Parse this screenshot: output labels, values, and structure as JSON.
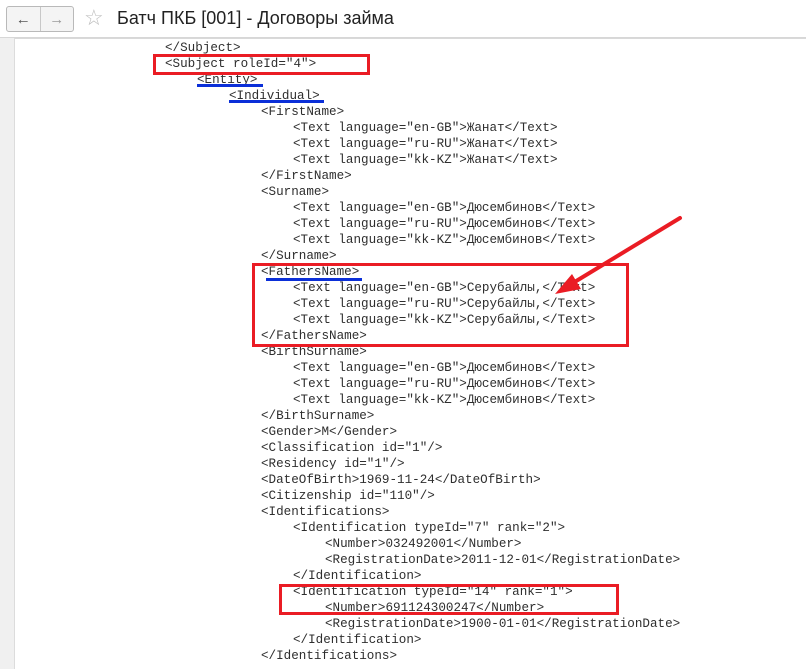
{
  "window": {
    "title": "Батч ПКБ [001] - Договоры займа",
    "back_glyph": "←",
    "forward_glyph": "→",
    "favorite_glyph": "☆"
  },
  "xml_lines": [
    "</Subject>",
    "<Subject roleId=\"4\">",
    "<Entity>",
    "<Individual>",
    "<FirstName>",
    "<Text language=\"en-GB\">Жанат</Text>",
    "<Text language=\"ru-RU\">Жанат</Text>",
    "<Text language=\"kk-KZ\">Жанат</Text>",
    "</FirstName>",
    "<Surname>",
    "<Text language=\"en-GB\">Дюсембинов</Text>",
    "<Text language=\"ru-RU\">Дюсембинов</Text>",
    "<Text language=\"kk-KZ\">Дюсембинов</Text>",
    "</Surname>",
    "<FathersName>",
    "<Text language=\"en-GB\">Серубайлы,</Text>",
    "<Text language=\"ru-RU\">Серубайлы,</Text>",
    "<Text language=\"kk-KZ\">Серубайлы,</Text>",
    "</FathersName>",
    "<BirthSurname>",
    "<Text language=\"en-GB\">Дюсембинов</Text>",
    "<Text language=\"ru-RU\">Дюсембинов</Text>",
    "<Text language=\"kk-KZ\">Дюсембинов</Text>",
    "</BirthSurname>",
    "<Gender>M</Gender>",
    "<Classification id=\"1\"/>",
    "<Residency id=\"1\"/>",
    "<DateOfBirth>1969-11-24</DateOfBirth>",
    "<Citizenship id=\"110\"/>",
    "<Identifications>",
    "<Identification typeId=\"7\" rank=\"2\">",
    "<Number>032492001</Number>",
    "<RegistrationDate>2011-12-01</RegistrationDate>",
    "</Identification>",
    "<Identification typeId=\"14\" rank=\"1\">",
    "<Number>691124300247</Number>",
    "<RegistrationDate>1900-01-01</RegistrationDate>",
    "</Identification>",
    "</Identifications>"
  ],
  "colors": {
    "highlight_box": "#ea1c24",
    "underline": "#0b2fd8",
    "text": "#2e2e2e"
  }
}
